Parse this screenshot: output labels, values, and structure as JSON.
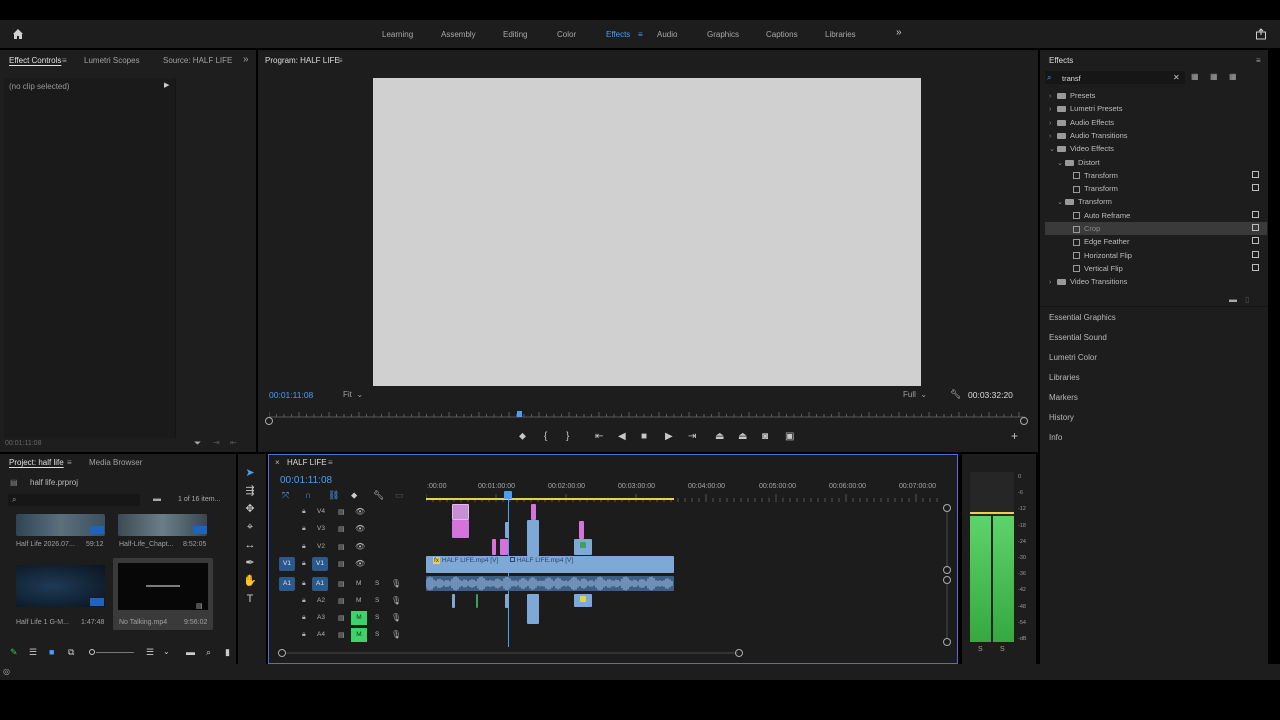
{
  "workspaces": {
    "tabs": [
      "Learning",
      "Assembly",
      "Editing",
      "Color",
      "Effects",
      "Audio",
      "Graphics",
      "Captions",
      "Libraries"
    ],
    "active": "Effects"
  },
  "source_panel": {
    "tabs": [
      "Effect Controls",
      "Lumetri Scopes",
      "Source: HALF LIFE"
    ],
    "no_clip": "(no clip selected)",
    "timecode": "00:01:11:08"
  },
  "program": {
    "title": "Program: HALF LIFE",
    "timecode": "00:01:11:08",
    "fit": "Fit",
    "quality": "Full",
    "duration": "00:03:32:20"
  },
  "project": {
    "tabs": [
      "Project: half life",
      "Media Browser"
    ],
    "file": "half life.prproj",
    "count": "1 of 16 item...",
    "items": [
      {
        "name": "Half Life 2026.07...",
        "duration": "59:12"
      },
      {
        "name": "Half-Life_Chapt...",
        "duration": "8:52:05"
      },
      {
        "name": "Half Life 1 G-M...",
        "duration": "1:47:48"
      },
      {
        "name": "No Talking.mp4",
        "duration": "9:56:02"
      }
    ]
  },
  "timeline": {
    "sequence": "HALF LIFE",
    "timecode": "00:01:11:08",
    "ruler": [
      ":00:00",
      "00:01:00:00",
      "00:02:00:00",
      "00:03:00:00",
      "00:04:00:00",
      "00:05:00:00",
      "00:06:00:00",
      "00:07:00:00"
    ],
    "video_tracks": [
      "V4",
      "V3",
      "V2",
      "V1"
    ],
    "audio_tracks": [
      "A1",
      "A2",
      "A3",
      "A4"
    ],
    "source_v": "V1",
    "source_a": "A1",
    "m_label": "M",
    "s_label": "S",
    "clip_labels": [
      "HALF LIFE.mp4 [V]",
      "HALF LIFE.mp4 [V]"
    ]
  },
  "effects": {
    "title": "Effects",
    "search": "transf",
    "tree": [
      {
        "label": "Presets",
        "level": 0
      },
      {
        "label": "Lumetri Presets",
        "level": 0
      },
      {
        "label": "Audio Effects",
        "level": 0
      },
      {
        "label": "Audio Transitions",
        "level": 0
      },
      {
        "label": "Video Effects",
        "level": 0
      },
      {
        "label": "Distort",
        "level": 1
      },
      {
        "label": "Transform",
        "level": 2
      },
      {
        "label": "Transform",
        "level": 2
      },
      {
        "label": "Transform",
        "level": 1
      },
      {
        "label": "Auto Reframe",
        "level": 2
      },
      {
        "label": "Crop",
        "level": 2
      },
      {
        "label": "Edge Feather",
        "level": 2
      },
      {
        "label": "Horizontal Flip",
        "level": 2
      },
      {
        "label": "Vertical Flip",
        "level": 2
      },
      {
        "label": "Video Transitions",
        "level": 0
      }
    ],
    "sections": [
      "Essential Graphics",
      "Essential Sound",
      "Lumetri Color",
      "Libraries",
      "Markers",
      "History",
      "Info"
    ]
  },
  "meter": {
    "scale": [
      "0",
      "-6",
      "-12",
      "-18",
      "-24",
      "-30",
      "-36",
      "-42",
      "-48",
      "-54",
      "-dB"
    ],
    "solo": [
      "S",
      "S"
    ]
  },
  "colors": {
    "accent": "#4a9ef5",
    "video_clip": "#7ea9d6",
    "pink_clip": "#d679d6",
    "meter_green": "#3fc24a"
  }
}
